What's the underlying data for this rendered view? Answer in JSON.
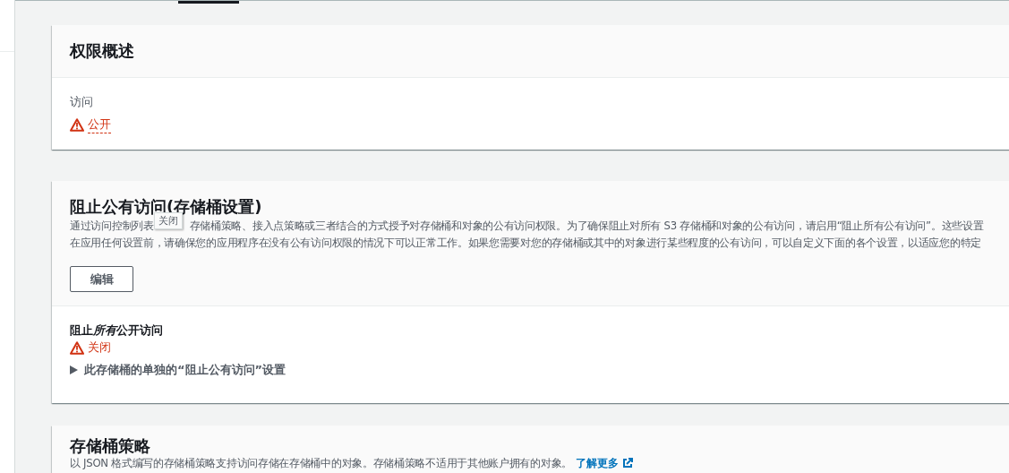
{
  "permissions_overview": {
    "title": "权限概述",
    "access": {
      "label": "访问",
      "status": "公开",
      "warning": true
    }
  },
  "block_public_access": {
    "title": "阻止公有访问(存储桶设置)",
    "tooltip": "关闭",
    "description_line_1_start": "通过访问控制列表",
    "description_line_1_end": "存储桶策略、接入点策略或三者结合的方式授予对存储桶和对象的公有访问权限。为了确保阻止对所有 S3 存储桶和对象的公有访问，请启用“阻止所有公有访问”。这些设置",
    "description_line_2": "在应用任何设置前，请确保您的应用程序在没有公有访问权限的情况下可以正常工作。如果您需要对您的存储桶或其中的对象进行某些程度的公有访问，可以自定义下面的各个设置，以适应您的特定",
    "edit_button": "编辑",
    "setting": {
      "title_start": "阻止",
      "title_emphasis": "所有",
      "title_end": "公开访问",
      "status": "关闭",
      "warning": true
    },
    "expander": {
      "label": "此存储桶的单独的“阻止公有访问”设置",
      "expanded": false
    }
  },
  "bucket_policy": {
    "title": "存储桶策略",
    "description": "以 JSON 格式编写的存储桶策略支持访问存储在存储桶中的对象。存储桶策略不适用于其他账户拥有的对象。",
    "link": "了解更多"
  }
}
